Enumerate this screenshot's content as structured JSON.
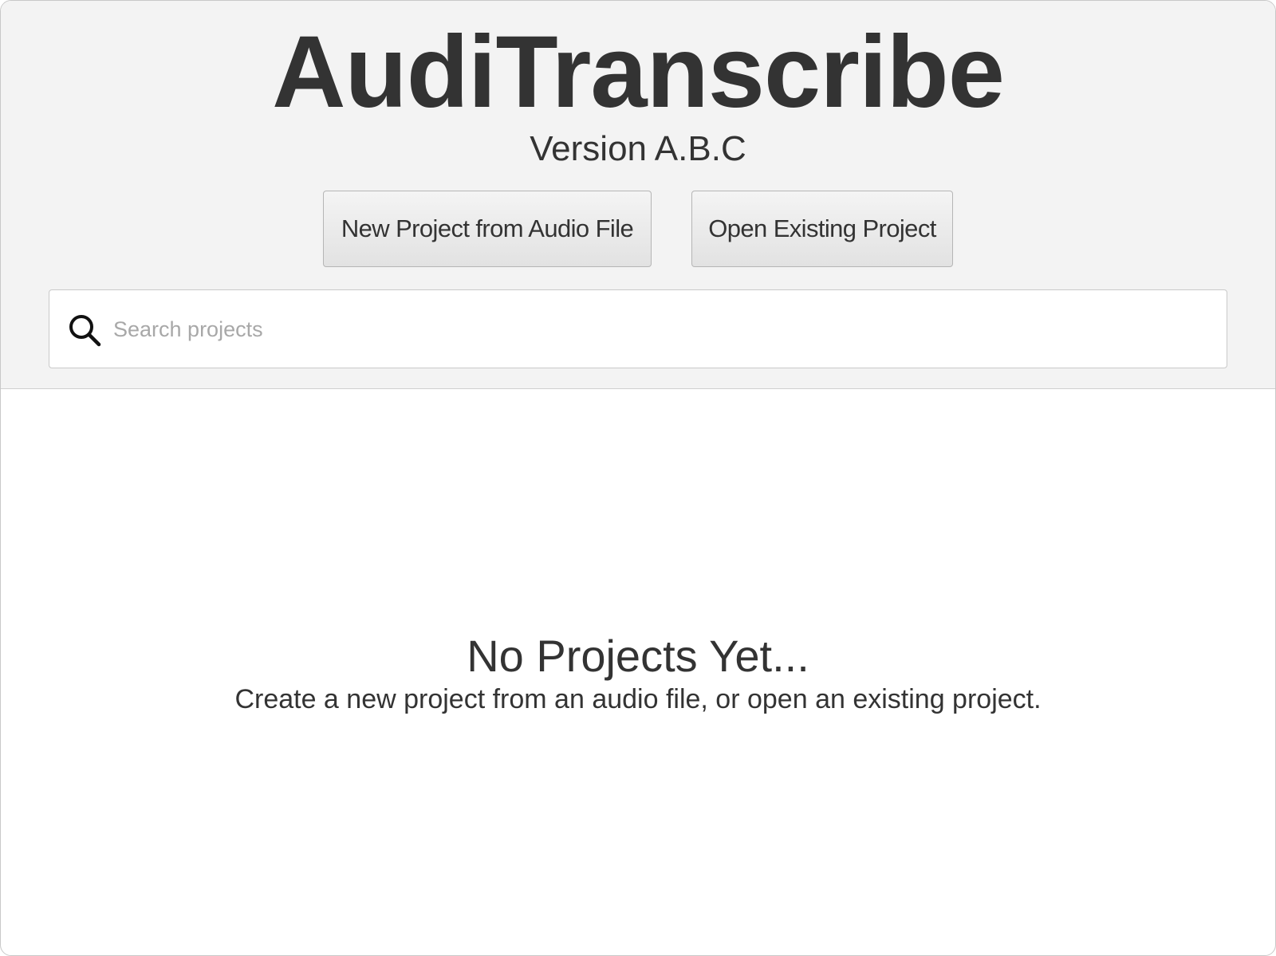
{
  "header": {
    "app_title": "AudiTranscribe",
    "version": "Version A.B.C",
    "new_project_label": "New Project from Audio File",
    "open_project_label": "Open Existing Project"
  },
  "search": {
    "placeholder": "Search projects",
    "value": "",
    "icon": "search-icon"
  },
  "empty_state": {
    "title": "No Projects Yet...",
    "subtitle": "Create a new project from an audio file, or open an existing project."
  },
  "colors": {
    "header_background": "#f3f3f3",
    "content_background": "#ffffff",
    "text": "#333333",
    "placeholder": "#a8a8a8"
  }
}
